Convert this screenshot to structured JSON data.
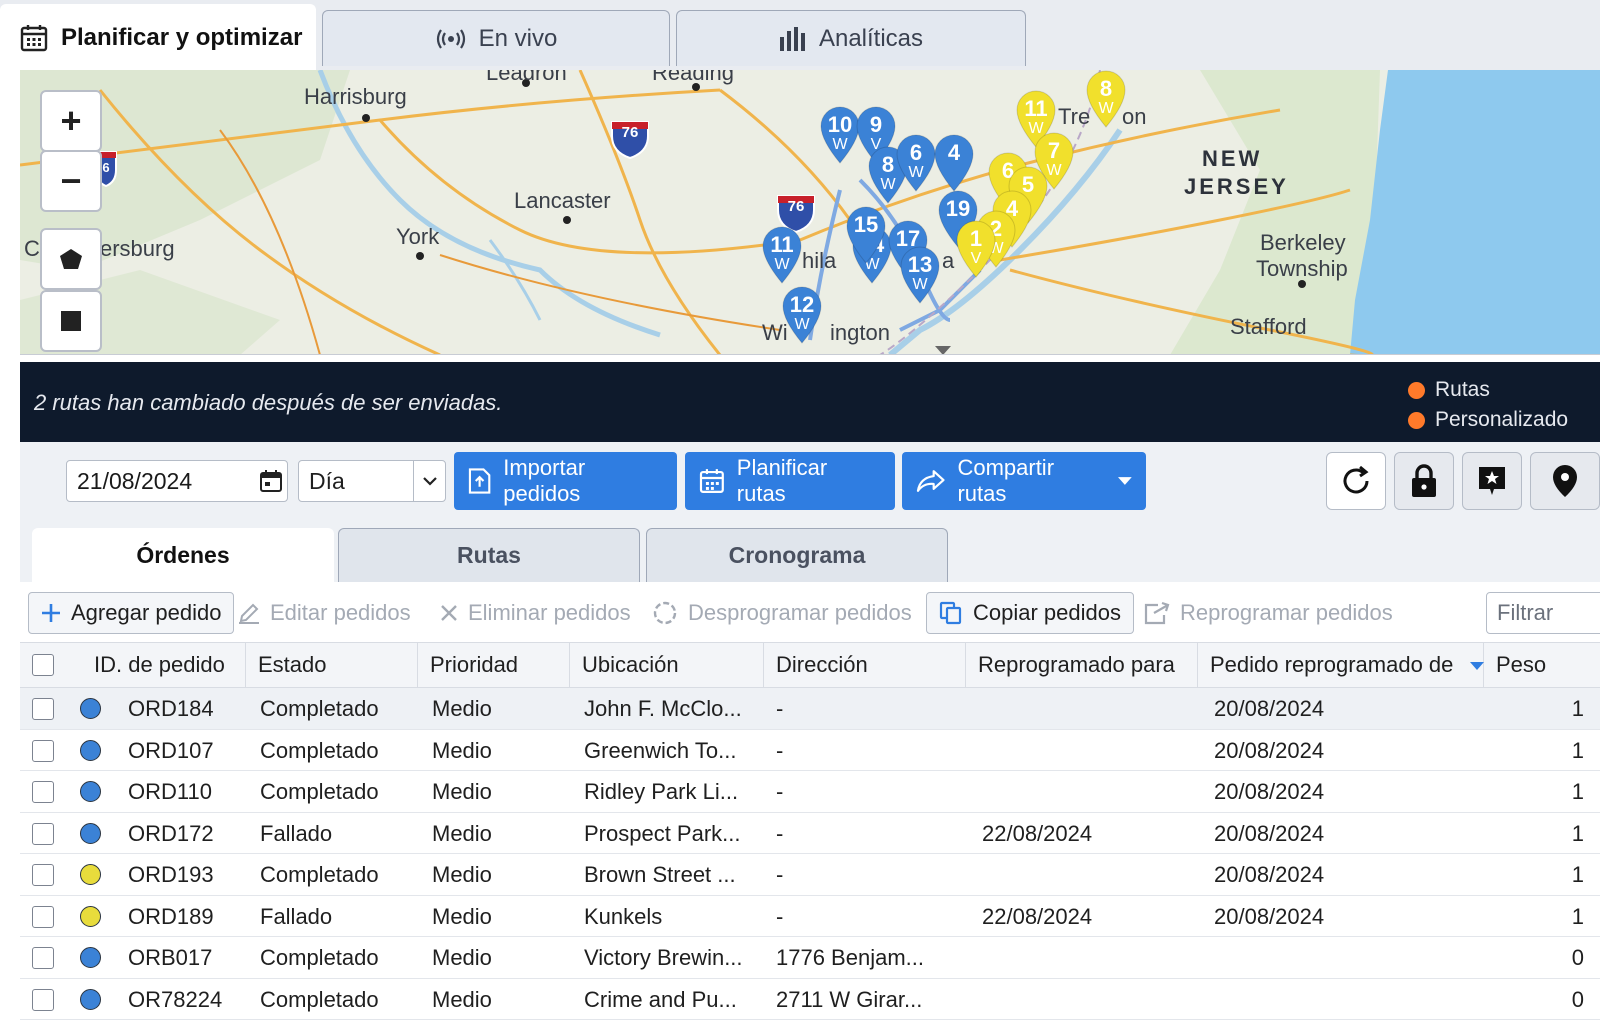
{
  "top_tabs": [
    {
      "label": "Planificar y optimizar",
      "icon": "calendar-icon",
      "active": true
    },
    {
      "label": "En vivo",
      "icon": "broadcast-icon",
      "active": false
    },
    {
      "label": "Analíticas",
      "icon": "bar-chart-icon",
      "active": false
    }
  ],
  "map": {
    "cities": [
      "Harrisburg",
      "Lancaster",
      "York",
      "ersburg",
      "Wi",
      "ington",
      "hila",
      "a",
      "Tre",
      "on",
      "Berkeley",
      "Township",
      "Stafford",
      "Leadron",
      "Reading",
      "C"
    ],
    "states": [
      "NEW",
      "JERSEY"
    ],
    "highway_shields": [
      "76",
      "76",
      "6"
    ],
    "zoom_in": "+",
    "zoom_out": "−",
    "pins_blue": [
      {
        "num": "10",
        "w": "W"
      },
      {
        "num": "9",
        "w": "V"
      },
      {
        "num": "8",
        "w": "W"
      },
      {
        "num": "6",
        "w": "W"
      },
      {
        "num": "4",
        "w": ""
      },
      {
        "num": "11",
        "w": "W"
      },
      {
        "num": "14",
        "w": "W"
      },
      {
        "num": "17",
        "w": ""
      },
      {
        "num": "13",
        "w": "W"
      },
      {
        "num": "12",
        "w": "W"
      },
      {
        "num": "15",
        "w": ""
      },
      {
        "num": "19",
        "w": ""
      }
    ],
    "pins_yellow": [
      {
        "num": "11",
        "w": "W"
      },
      {
        "num": "8",
        "w": "W"
      },
      {
        "num": "7",
        "w": "W"
      },
      {
        "num": "6",
        "w": ""
      },
      {
        "num": "5",
        "w": ""
      },
      {
        "num": "4",
        "w": ""
      },
      {
        "num": "2",
        "w": "W"
      },
      {
        "num": "1",
        "w": "V"
      }
    ]
  },
  "banner": {
    "message": "2 rutas han cambiado después de ser enviadas.",
    "legend": [
      "Rutas",
      "Personalizado"
    ],
    "legend_color": "#ff7a2a"
  },
  "toolbar": {
    "date_value": "21/08/2024",
    "period_value": "Día",
    "import_label": "Importar pedidos",
    "plan_label": "Planificar rutas",
    "share_label": "Compartir rutas",
    "accent": "#2f7de1"
  },
  "sub_tabs": [
    {
      "label": "Órdenes",
      "active": true
    },
    {
      "label": "Rutas",
      "active": false
    },
    {
      "label": "Cronograma",
      "active": false
    }
  ],
  "actions": {
    "add": "Agregar pedido",
    "edit": "Editar pedidos",
    "delete": "Eliminar pedidos",
    "unschedule": "Desprogramar pedidos",
    "copy": "Copiar pedidos",
    "reschedule": "Reprogramar pedidos",
    "filter_placeholder": "Filtrar"
  },
  "table": {
    "columns": [
      "ID. de pedido",
      "Estado",
      "Prioridad",
      "Ubicación",
      "Dirección",
      "Reprogramado para",
      "Pedido reprogramado de",
      "Peso"
    ],
    "rows": [
      {
        "color": "#3b82d6",
        "id": "ORD184",
        "estado": "Completado",
        "prioridad": "Medio",
        "ubicacion": "John F. McClo...",
        "direccion": "-",
        "reprogramado_para": "",
        "reprogramado_de": "20/08/2024",
        "peso": "1"
      },
      {
        "color": "#3b82d6",
        "id": "ORD107",
        "estado": "Completado",
        "prioridad": "Medio",
        "ubicacion": "Greenwich To...",
        "direccion": "-",
        "reprogramado_para": "",
        "reprogramado_de": "20/08/2024",
        "peso": "1"
      },
      {
        "color": "#3b82d6",
        "id": "ORD110",
        "estado": "Completado",
        "prioridad": "Medio",
        "ubicacion": "Ridley Park Li...",
        "direccion": "-",
        "reprogramado_para": "",
        "reprogramado_de": "20/08/2024",
        "peso": "1"
      },
      {
        "color": "#3b82d6",
        "id": "ORD172",
        "estado": "Fallado",
        "prioridad": "Medio",
        "ubicacion": "Prospect Park...",
        "direccion": "-",
        "reprogramado_para": "22/08/2024",
        "reprogramado_de": "20/08/2024",
        "peso": "1"
      },
      {
        "color": "#e8dc3c",
        "id": "ORD193",
        "estado": "Completado",
        "prioridad": "Medio",
        "ubicacion": "Brown Street ...",
        "direccion": "-",
        "reprogramado_para": "",
        "reprogramado_de": "20/08/2024",
        "peso": "1"
      },
      {
        "color": "#e8dc3c",
        "id": "ORD189",
        "estado": "Fallado",
        "prioridad": "Medio",
        "ubicacion": "Kunkels",
        "direccion": "-",
        "reprogramado_para": "22/08/2024",
        "reprogramado_de": "20/08/2024",
        "peso": "1"
      },
      {
        "color": "#3b82d6",
        "id": "ORB017",
        "estado": "Completado",
        "prioridad": "Medio",
        "ubicacion": "Victory Brewin...",
        "direccion": "1776 Benjam...",
        "reprogramado_para": "",
        "reprogramado_de": "",
        "peso": "0"
      },
      {
        "color": "#3b82d6",
        "id": "OR78224",
        "estado": "Completado",
        "prioridad": "Medio",
        "ubicacion": "Crime and Pu...",
        "direccion": "2711 W Girar...",
        "reprogramado_para": "",
        "reprogramado_de": "",
        "peso": "0"
      }
    ]
  }
}
